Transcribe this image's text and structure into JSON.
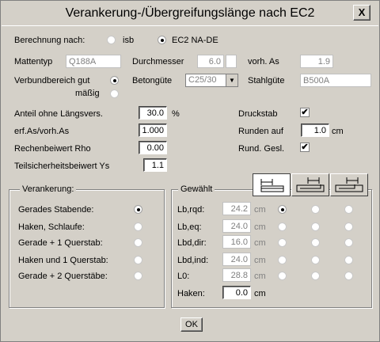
{
  "window": {
    "title": "Verankerung-/Übergreifungslänge nach EC2",
    "close_glyph": "X"
  },
  "berechnung": {
    "label": "Berechnung nach:",
    "option_isb": "isb",
    "option_ec2": "EC2 NA-DE",
    "selected": "EC2 NA-DE"
  },
  "mattentyp": {
    "label": "Mattentyp",
    "value": "Q188A"
  },
  "durchmesser": {
    "label": "Durchmesser",
    "value": "6.0",
    "suffix": ""
  },
  "vorh_as": {
    "label": "vorh. As",
    "value": "1.9"
  },
  "verbundbereich": {
    "label": "Verbundbereich gut",
    "option_maessig": "mäßig",
    "selected": "gut"
  },
  "betonguete": {
    "label": "Betongüte",
    "value": "C25/30"
  },
  "stahlguete": {
    "label": "Stahlgüte",
    "value": "B500A"
  },
  "anteil": {
    "label": "Anteil ohne Längsvers.",
    "value": "30.0",
    "unit": "%"
  },
  "erf_as": {
    "label": "erf.As/vorh.As",
    "value": "1.000"
  },
  "rechenbeiwert": {
    "label": "Rechenbeiwert Rho",
    "value": "0.00"
  },
  "teilsicherheit": {
    "label": "Teilsicherheitsbeiwert Ys",
    "value": "1.1"
  },
  "druckstab": {
    "label": "Druckstab",
    "checked": true
  },
  "runden": {
    "label": "Runden auf",
    "value": "1.0",
    "unit": "cm"
  },
  "rund_gesl": {
    "label": "Rund. Gesl.",
    "checked": true
  },
  "check_glyph": "✔",
  "verankerung": {
    "title": "Verankerung:",
    "options": [
      "Gerades Stabende:",
      "Haken, Schlaufe:",
      "Gerade + 1 Querstab:",
      "Haken und 1 Querstab:",
      "Gerade + 2 Querstäbe:"
    ],
    "selected_index": 0
  },
  "gewaehlt": {
    "title": "Gewählt",
    "rows": [
      {
        "label": "Lb,rqd:",
        "value": "24.2",
        "unit": "cm"
      },
      {
        "label": "Lb,eq:",
        "value": "24.0",
        "unit": "cm"
      },
      {
        "label": "Lbd,dir:",
        "value": "16.0",
        "unit": "cm"
      },
      {
        "label": "Lbd,ind:",
        "value": "24.0",
        "unit": "cm"
      },
      {
        "label": "L0:",
        "value": "28.8",
        "unit": "cm"
      }
    ],
    "haken": {
      "label": "Haken:",
      "value": "0.0",
      "unit": "cm"
    },
    "selected_row": 0,
    "selected_col": 0
  },
  "ok_label": "OK"
}
